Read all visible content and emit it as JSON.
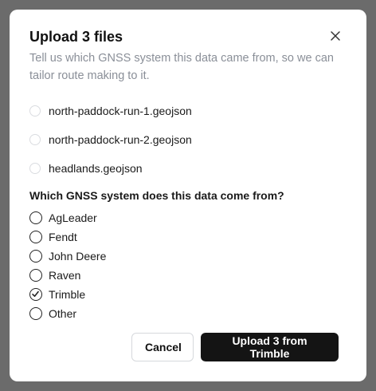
{
  "dialog": {
    "title": "Upload 3 files",
    "subtitle": "Tell us which GNSS system this data came from, so we can tailor route making to it.",
    "close_icon": "close-icon"
  },
  "files": [
    {
      "name": "north-paddock-run-1.geojson"
    },
    {
      "name": "north-paddock-run-2.geojson"
    },
    {
      "name": "headlands.geojson"
    }
  ],
  "gnss": {
    "question": "Which GNSS system does this data come from?",
    "selected": "Trimble",
    "options": [
      {
        "label": "AgLeader",
        "checked": false
      },
      {
        "label": "Fendt",
        "checked": false
      },
      {
        "label": "John Deere",
        "checked": false
      },
      {
        "label": "Raven",
        "checked": false
      },
      {
        "label": "Trimble",
        "checked": true
      },
      {
        "label": "Other",
        "checked": false
      }
    ]
  },
  "footer": {
    "cancel_label": "Cancel",
    "upload_label": "Upload 3 from Trimble"
  },
  "colors": {
    "backdrop": "#6b6b6b",
    "primary_button": "#141414",
    "subtitle_text": "#8a8f98"
  }
}
